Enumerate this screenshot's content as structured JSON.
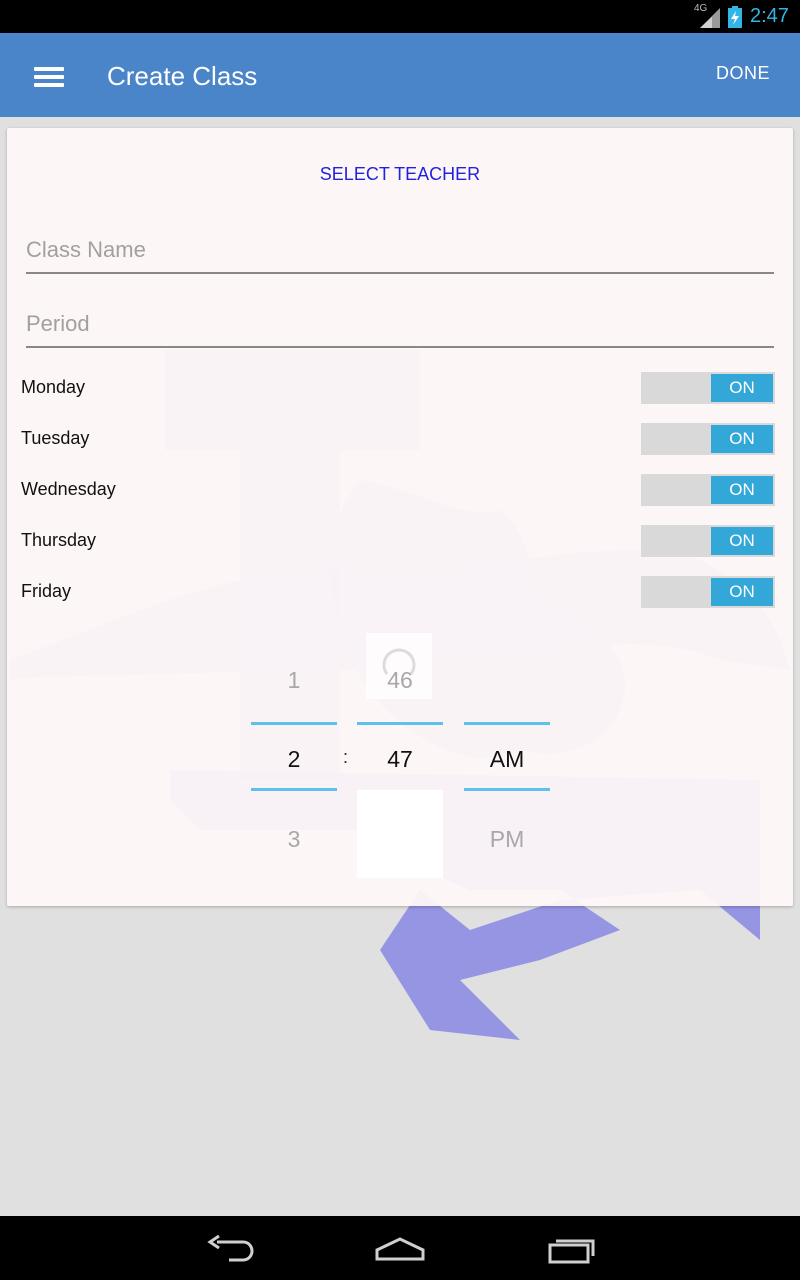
{
  "status_bar": {
    "network": "4G",
    "time": "2:47"
  },
  "action_bar": {
    "title": "Create Class",
    "done_label": "DONE"
  },
  "form": {
    "select_teacher_label": "SELECT TEACHER",
    "class_name": {
      "placeholder": "Class Name",
      "value": ""
    },
    "period": {
      "placeholder": "Period",
      "value": ""
    }
  },
  "days": [
    {
      "label": "Monday",
      "toggle": "ON"
    },
    {
      "label": "Tuesday",
      "toggle": "ON"
    },
    {
      "label": "Wednesday",
      "toggle": "ON"
    },
    {
      "label": "Thursday",
      "toggle": "ON"
    },
    {
      "label": "Friday",
      "toggle": "ON"
    }
  ],
  "time_picker": {
    "hour": {
      "prev": "1",
      "selected": "2",
      "next": "3"
    },
    "separator": ":",
    "minute": {
      "prev": "46",
      "selected": "47"
    },
    "ampm": {
      "selected": "AM",
      "next": "PM"
    }
  },
  "colors": {
    "action_bar": "#4a84c9",
    "toggle_on": "#33a8d8",
    "accent_line": "#60c0ec",
    "link_blue": "#2222dd"
  },
  "icons": [
    "menu-icon",
    "back-icon",
    "home-icon",
    "recents-icon",
    "signal-icon",
    "battery-icon"
  ]
}
